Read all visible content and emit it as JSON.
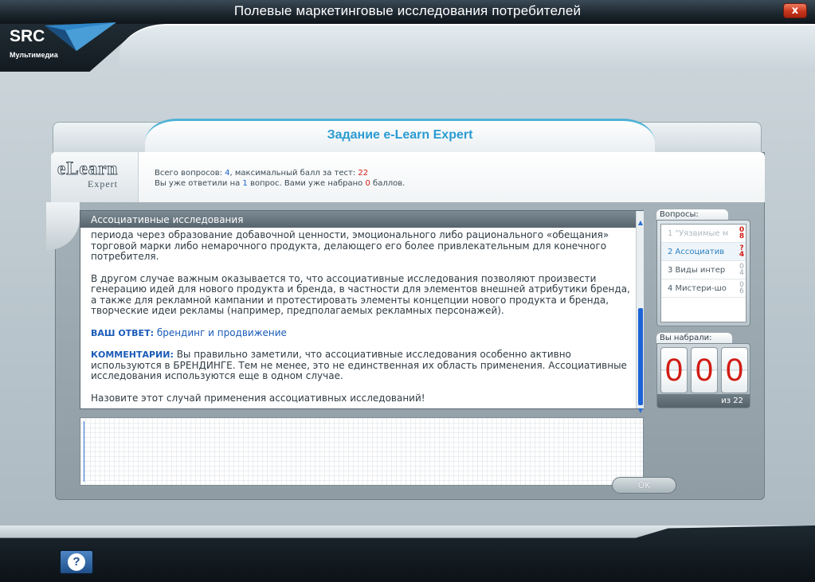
{
  "window": {
    "title": "Полевые маркетинговые исследования потребителей",
    "close_label": "x"
  },
  "brand": {
    "logo_text": "SRC",
    "logo_subtitle": "Мультимедиа"
  },
  "dialog": {
    "title": "Задание e-Learn Expert",
    "logo_word_1": "eLearn",
    "logo_word_2": "Expert",
    "stats": {
      "line1_prefix": "Всего вопросов: ",
      "total_questions": "4",
      "line1_middle": ", максимальный балл за тест: ",
      "max_score": "22",
      "line2_prefix": "Вы уже ответили на ",
      "answered_count": "1",
      "line2_middle": " вопрос. Вами уже набрано ",
      "scored_points": "0",
      "line2_suffix": " баллов."
    }
  },
  "question_panel": {
    "header": "Ассоциативные исследования",
    "paragraph_1": "периода через образование добавочной ценности, эмоционального либо рационального «обещания» торговой марки либо немарочного продукта, делающего его более привлекательным для конечного потребителя.",
    "paragraph_2": "В другом случае важным оказывается то, что ассоциативные исследования позволяют произвести генерацию идей для нового продукта и бренда, в частности для элементов внешней атрибутики бренда, а также для рекламной кампании и протестировать элементы концепции нового продукта и бренда, творческие идеи рекламы (например, предполагаемых рекламных персонажей).",
    "answer_label": "ВАШ ОТВЕТ:",
    "answer_value": "брендинг и продвижение",
    "comment_label": "КОММЕНТАРИИ:",
    "comment_text": "Вы правильно заметили, что ассоциативные исследования особенно активно используются в БРЕНДИНГЕ. Тем не менее, это не единственная их область применения. Ассоциативные исследования используются еще в одном случае.",
    "prompt": "Назовите этот случай применения ассоциативных исследований!",
    "scroll_up": "▲",
    "scroll_down": "▼"
  },
  "answer_input": {
    "value": "",
    "placeholder": ""
  },
  "ok_button": "OK",
  "questions_list": {
    "label": "Вопросы:",
    "items": [
      {
        "label": "1 \"Уязвимые м",
        "score_top": "0",
        "score_bottom": "8",
        "state": "done"
      },
      {
        "label": "2 Ассоциатив",
        "score_top": "?",
        "score_bottom": "4",
        "state": "current"
      },
      {
        "label": "3 Виды интер",
        "score_top": "0",
        "score_bottom": "4",
        "state": "pending"
      },
      {
        "label": "4 Мистери-шо",
        "score_top": "0",
        "score_bottom": "6",
        "state": "pending"
      }
    ]
  },
  "score_panel": {
    "label": "Вы набрали:",
    "digits": [
      "0",
      "0",
      "0"
    ],
    "max_text": "из 22"
  },
  "help_button": "?",
  "colors": {
    "accent": "#2b9bd2",
    "highlight_red": "#d11c14",
    "link_blue": "#1a5bb8"
  }
}
